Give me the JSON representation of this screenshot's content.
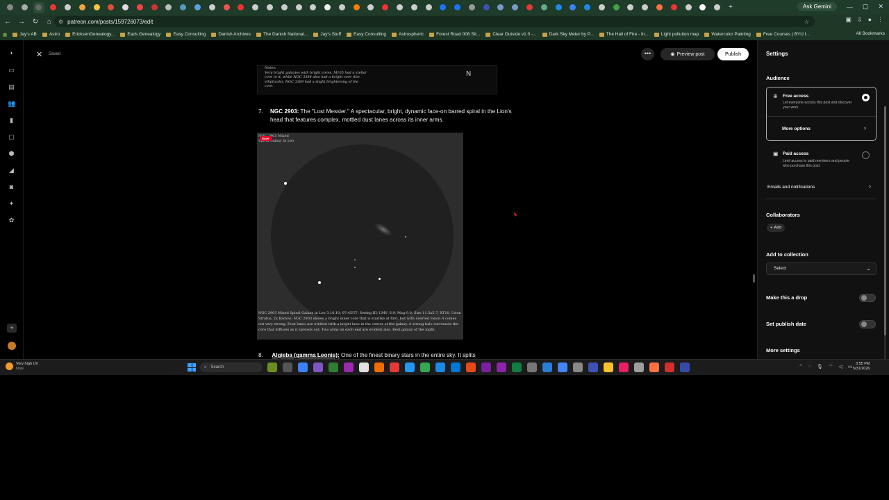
{
  "browser": {
    "tab_icons": [
      {
        "name": "app-icon",
        "color": "#888"
      },
      {
        "name": "browser-icon",
        "color": "#aaa"
      },
      {
        "name": "active-tab-icon",
        "color": "#666"
      },
      {
        "name": "youtube-icon",
        "color": "#e53935"
      },
      {
        "name": "chrome-icon",
        "color": "#ccc"
      },
      {
        "name": "bookmark-tab-icon",
        "color": "#f2a33a"
      },
      {
        "name": "star-tab-icon",
        "color": "#f2c744"
      },
      {
        "name": "gmail-icon",
        "color": "#e04b3c"
      },
      {
        "name": "s-icon",
        "color": "#ddd"
      },
      {
        "name": "red-tab-icon",
        "color": "#e44"
      },
      {
        "name": "red-tab-icon-2",
        "color": "#c33"
      },
      {
        "name": "tab-icon",
        "color": "#bbb"
      },
      {
        "name": "cloud-tab-icon",
        "color": "#59b"
      },
      {
        "name": "w-tab-icon",
        "color": "#5aa0e0"
      },
      {
        "name": "globe-tab-icon",
        "color": "#ccc"
      },
      {
        "name": "fire-tab-icon",
        "color": "#ef5350"
      },
      {
        "name": "red-circle-tab-icon",
        "color": "#e33"
      },
      {
        "name": "globe-tab-icon-2",
        "color": "#ccc"
      },
      {
        "name": "globe-tab-icon-3",
        "color": "#ccc"
      },
      {
        "name": "tab-icon-2",
        "color": "#ccc"
      },
      {
        "name": "globe-tab-icon-4",
        "color": "#ccc"
      },
      {
        "name": "tab-icon-3",
        "color": "#ccc"
      },
      {
        "name": "moon-tab-icon",
        "color": "#eee"
      },
      {
        "name": "globe-tab-icon-5",
        "color": "#ccc"
      },
      {
        "name": "orange-tab-icon",
        "color": "#f57c00"
      },
      {
        "name": "globe-tab-icon-6",
        "color": "#ccc"
      },
      {
        "name": "red-tab-icon-3",
        "color": "#e33"
      },
      {
        "name": "globe-tab-icon-7",
        "color": "#ccc"
      },
      {
        "name": "tab-icon-4",
        "color": "#ccc"
      },
      {
        "name": "globe-tab-icon-8",
        "color": "#ccc"
      },
      {
        "name": "facebook-icon",
        "color": "#1877f2"
      },
      {
        "name": "facebook-icon-2",
        "color": "#1877f2"
      },
      {
        "name": "loading-tab-icon",
        "color": "#999"
      },
      {
        "name": "blue-tab-icon",
        "color": "#3f51b5"
      },
      {
        "name": "arrow-tab-icon",
        "color": "#79c"
      },
      {
        "name": "arrow-tab-icon-2",
        "color": "#79c"
      },
      {
        "name": "pdf-tab-icon",
        "color": "#e53935"
      },
      {
        "name": "tab-icon-5",
        "color": "#6a8"
      },
      {
        "name": "blue-tab-icon-2",
        "color": "#1e88e5"
      },
      {
        "name": "doc-tab-icon",
        "color": "#3b82f6"
      },
      {
        "name": "blue-tab-icon-3",
        "color": "#1e88e5"
      },
      {
        "name": "globe-tab-icon-9",
        "color": "#ccc"
      },
      {
        "name": "green-tab-icon",
        "color": "#43a047"
      },
      {
        "name": "globe-tab-icon-10",
        "color": "#ccc"
      },
      {
        "name": "globe-tab-icon-11",
        "color": "#ccc"
      },
      {
        "name": "orange-tab-icon-2",
        "color": "#ff7043"
      },
      {
        "name": "red-tab-icon-4",
        "color": "#e33"
      },
      {
        "name": "globe-tab-icon-12",
        "color": "#ccc"
      },
      {
        "name": "x-tab-icon",
        "color": "#fff"
      },
      {
        "name": "globe-tab-icon-13",
        "color": "#ccc"
      }
    ],
    "new_tab": "+",
    "gemini_label": "Ask Gemini",
    "window_controls": [
      "—",
      "▢",
      "✕"
    ],
    "url": "patreon.com/posts/159726073/edit",
    "bookmarks": [
      "Jay's AB",
      "Astro",
      "EricksenGenealogy...",
      "Eads Genealogy",
      "Easy Consulting",
      "Danish Archives",
      "The Danish National...",
      "Jay's Stuff",
      "Easy Consulting",
      "Astrospheric",
      "Forest Road 006 Sit...",
      "Clear Outside v1.0 -...",
      "Dark Sky Meter by P...",
      "The Hall of Fire - In...",
      "Light pollution map",
      "Watercolor Painting",
      "Free Courses | BYU I..."
    ],
    "all_bookmarks": "All Bookmarks"
  },
  "editor": {
    "status": "Saved",
    "preview_label": "Preview post",
    "publish_label": "Publish",
    "notes_lines": [
      "Notes:",
      "Very bright galaxies with bright cores. M105 had a stellar",
      "core to it, while NGC 3384 also had a bright core (the",
      "ellipticals). NGC 3389 had a slight brightening of the",
      "core."
    ],
    "notes_mark": "N",
    "item7": {
      "number": "7.",
      "name": "NGC 2903:",
      "text": " The \"Lost Messier.\" A spectacular, bright, dynamic face-on barred spiral in the Lion's head that features complex, mottled dust lanes across its inner arms."
    },
    "sketch": {
      "header_lines": [
        "NGC 2903 Mixed",
        "Spiral Galaxy in Leo"
      ],
      "save_label": "Save",
      "caption": "NGC 2903 Mixed Spiral Galaxy in Leo 3.16.10; 07:45UT: Seeing III; LMV: 6.9; Mag:9.0; Size 11.5x5.7; XT10, Unun Stratus, 2x Barlow; NGC 2903 shows a bright inner core that is starlike at first, but with averted vision it comes out very strong. Dust lanes are evident with a bright lane in the center of the galaxy. A strong halo surrounds the core that diffuses as it spreads out. Two arms on each end are evident also. Best galaxy of the night."
    },
    "item8": {
      "number": "8.",
      "name": "Algieba (gamma Leonis):",
      "text": " One of the finest binary stars in the entire sky. It splits"
    }
  },
  "settings": {
    "title": "Settings",
    "audience_title": "Audience",
    "free_access": {
      "title": "Free access",
      "desc": "Let everyone access this post and discover your work"
    },
    "more_options": "More options",
    "paid_access": {
      "title": "Paid access",
      "desc": "Limit access to paid members and people who purchase this post."
    },
    "emails": "Emails and notifications",
    "collaborators_title": "Collaborators",
    "add_label": "Add",
    "collection_title": "Add to collection",
    "select_label": "Select",
    "drop_label": "Make this a drop",
    "publish_date_label": "Set publish date",
    "more_settings": "More settings"
  },
  "taskbar": {
    "weather_title": "Very high UV",
    "weather_sub": "Now",
    "search_placeholder": "Search",
    "time": "3:55 PM",
    "date": "5/31/2026",
    "app_colors": [
      "#6b8e23",
      "#555",
      "#3b82f6",
      "#7e57c2",
      "#2e7d32",
      "#9c27b0",
      "#e0e0e0",
      "#ef6c00",
      "#e53935",
      "#2196f3",
      "#34a853",
      "#1e88e5",
      "#0078d4",
      "#e64a19",
      "#7b1fa2",
      "#8e24aa",
      "#107c41",
      "#777",
      "#2b7cd3",
      "#4285f4",
      "#888",
      "#3f51b5",
      "#fbc02d",
      "#e91e63",
      "#9e9e9e",
      "#ff7043",
      "#d32f2f",
      "#3949ab"
    ]
  }
}
